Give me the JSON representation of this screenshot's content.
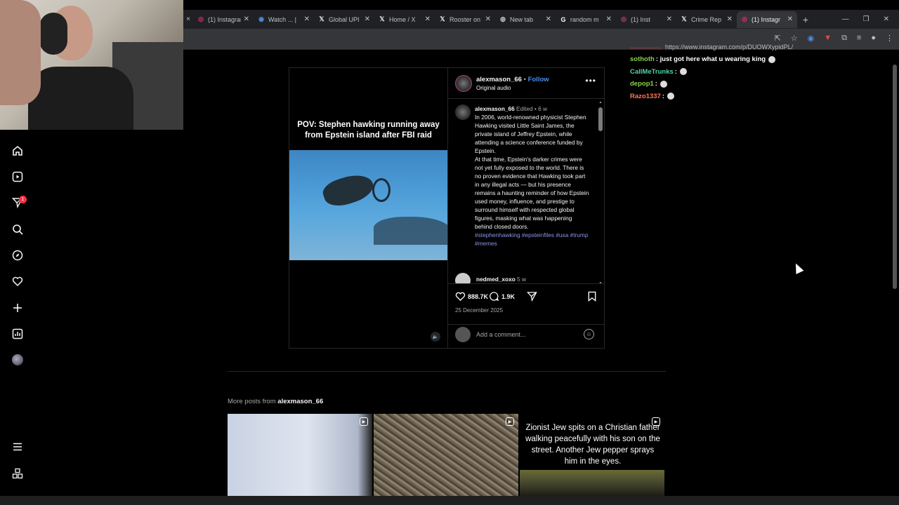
{
  "browser": {
    "first_tab_close": "×",
    "tabs": [
      {
        "title": "(1) Instagram",
        "favicon": "instagram-icon",
        "active": false
      },
      {
        "title": "Watch ... |",
        "favicon": "watch-icon",
        "active": false
      },
      {
        "title": "Global UPI",
        "favicon": "x-icon",
        "active": false
      },
      {
        "title": "Home / X",
        "favicon": "x-icon",
        "active": false
      },
      {
        "title": "Rooster on",
        "favicon": "x-icon",
        "active": false
      },
      {
        "title": "New tab",
        "favicon": "chrome-icon",
        "active": false
      },
      {
        "title": "random m",
        "favicon": "google-icon",
        "active": false
      },
      {
        "title": "(1) Inst",
        "favicon": "instagram-icon",
        "active": false
      },
      {
        "title": "Crime Rep",
        "favicon": "x-icon",
        "active": false
      },
      {
        "title": "(1) Instagr",
        "favicon": "instagram-icon",
        "active": true
      }
    ],
    "new_tab": "+",
    "window_controls": [
      "—",
      "❐",
      "✕"
    ]
  },
  "sidebar": {
    "items": [
      "home-icon",
      "reels-icon",
      "messages-icon",
      "search-icon",
      "explore-icon",
      "notifications-icon",
      "create-icon",
      "dashboard-icon",
      "profile-avatar"
    ],
    "messages_badge": "1",
    "bottom": [
      "menu-icon",
      "apps-icon"
    ]
  },
  "post": {
    "media_caption": "POV: Stephen hawking running away from Epstein island after FBI raid",
    "username": "alexmason_66",
    "separator": "•",
    "follow": "Follow",
    "audio": "Original audio",
    "caption": {
      "username": "alexmason_66",
      "meta": "Edited • 6 w",
      "paragraph1": "In 2006, world-renowned physicist Stephen Hawking visited Little Saint James, the private island of Jeffrey Epstein, while attending a science conference funded by Epstein.",
      "paragraph2": "At that time, Epstein's darker crimes were not yet fully exposed to the world. There is no proven evidence that Hawking took part in any illegal acts — but his presence remains a haunting reminder of how Epstein used money, influence, and prestige to surround himself with respected global figures, masking what was happening behind closed doors.",
      "hashtags": "#stephenhawking #epsteinfiles #usa #trump #memes"
    },
    "comment": {
      "username": "nedmed_xoxo",
      "meta": "5 w"
    },
    "likes": "888.7K",
    "comments": "1.9K",
    "date": "25 December 2025",
    "add_comment_placeholder": "Add a comment..."
  },
  "more_posts": {
    "prefix": "More posts from",
    "username": "alexmason_66",
    "thumb3_text": "Zionist Jew spits on a Christian father walking peacefully with his son on the street. Another Jew pepper sprays him in the eyes."
  },
  "chat": {
    "url": "https://www.instagram.com/p/DUOWXypidPL/",
    "messages": [
      {
        "user": "sothoth",
        "text": ": just got here what u wearing king",
        "color": "#8bd04a"
      },
      {
        "user": "CallMeTrunks",
        "text": ":",
        "color": "#4fd6a8"
      },
      {
        "user": "depop1",
        "text": ":",
        "color": "#8bd04a"
      },
      {
        "user": "Razo1337",
        "text": ":",
        "color": "#ff7a5c"
      }
    ]
  }
}
